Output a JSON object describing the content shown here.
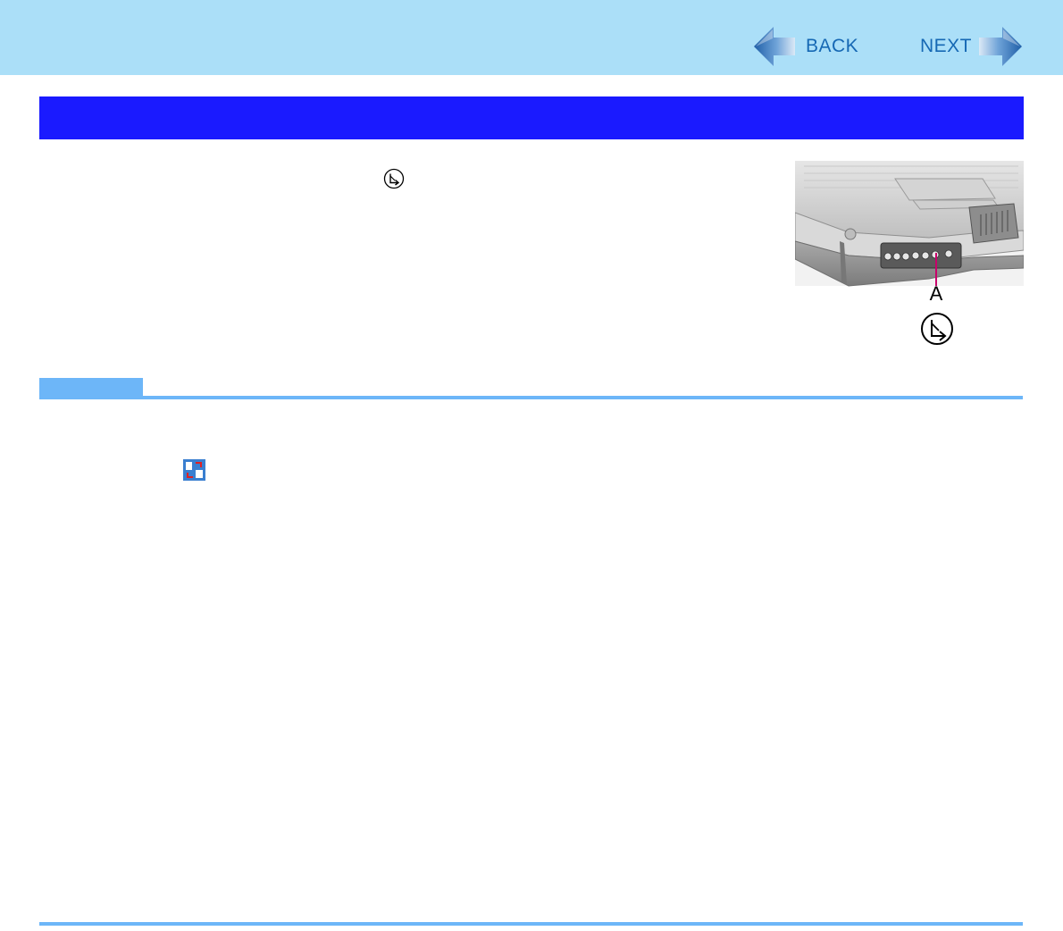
{
  "nav": {
    "back_label": "BACK",
    "next_label": "NEXT"
  },
  "title_bar": {
    "color": "#1a1aff"
  },
  "illustration": {
    "callout_letter": "A",
    "icon": "rotation-button-icon"
  },
  "note": {
    "color": "#6db6f8"
  },
  "inline_icons": {
    "key_icon": "rotation-key-icon",
    "app_icon": "rotation-utility-icon"
  }
}
